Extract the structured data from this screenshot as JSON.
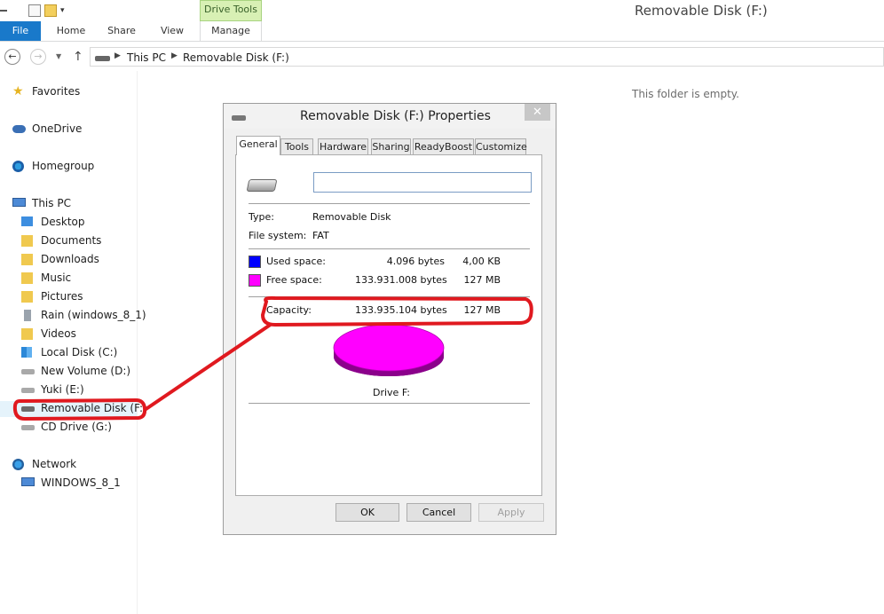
{
  "window": {
    "title": "Removable Disk (F:)"
  },
  "ribbon": {
    "context_group": "Drive Tools",
    "tabs": [
      "File",
      "Home",
      "Share",
      "View",
      "Manage"
    ]
  },
  "address": {
    "crumbs": [
      "This PC",
      "Removable Disk (F:)"
    ]
  },
  "nav": {
    "favorites": "Favorites",
    "onedrive": "OneDrive",
    "homegroup": "Homegroup",
    "thispc": "This PC",
    "thispc_items": [
      "Desktop",
      "Documents",
      "Downloads",
      "Music",
      "Pictures",
      "Rain (windows_8_1)",
      "Videos",
      "Local Disk (C:)",
      "New Volume (D:)",
      "Yuki (E:)",
      "Removable Disk (F:)",
      "CD Drive (G:)"
    ],
    "network": "Network",
    "network_items": [
      "WINDOWS_8_1"
    ]
  },
  "content": {
    "empty_message": "This folder is empty."
  },
  "dialog": {
    "title": "Removable Disk (F:) Properties",
    "close_glyph": "✕",
    "tabs": [
      "General",
      "Tools",
      "Hardware",
      "Sharing",
      "ReadyBoost",
      "Customize"
    ],
    "name_value": "",
    "type_label": "Type:",
    "type_value": "Removable Disk",
    "fs_label": "File system:",
    "fs_value": "FAT",
    "used_label": "Used space:",
    "used_bytes": "4.096 bytes",
    "used_size": "4,00 KB",
    "free_label": "Free space:",
    "free_bytes": "133.931.008 bytes",
    "free_size": "127 MB",
    "capacity_label": "Capacity:",
    "capacity_bytes": "133.935.104 bytes",
    "capacity_size": "127 MB",
    "drive_caption": "Drive F:",
    "buttons": {
      "ok": "OK",
      "cancel": "Cancel",
      "apply": "Apply"
    },
    "colors": {
      "used": "#0000ff",
      "free": "#ff00ff",
      "free_side": "#8b008b"
    }
  },
  "annotation": {
    "color": "#e0191f"
  }
}
